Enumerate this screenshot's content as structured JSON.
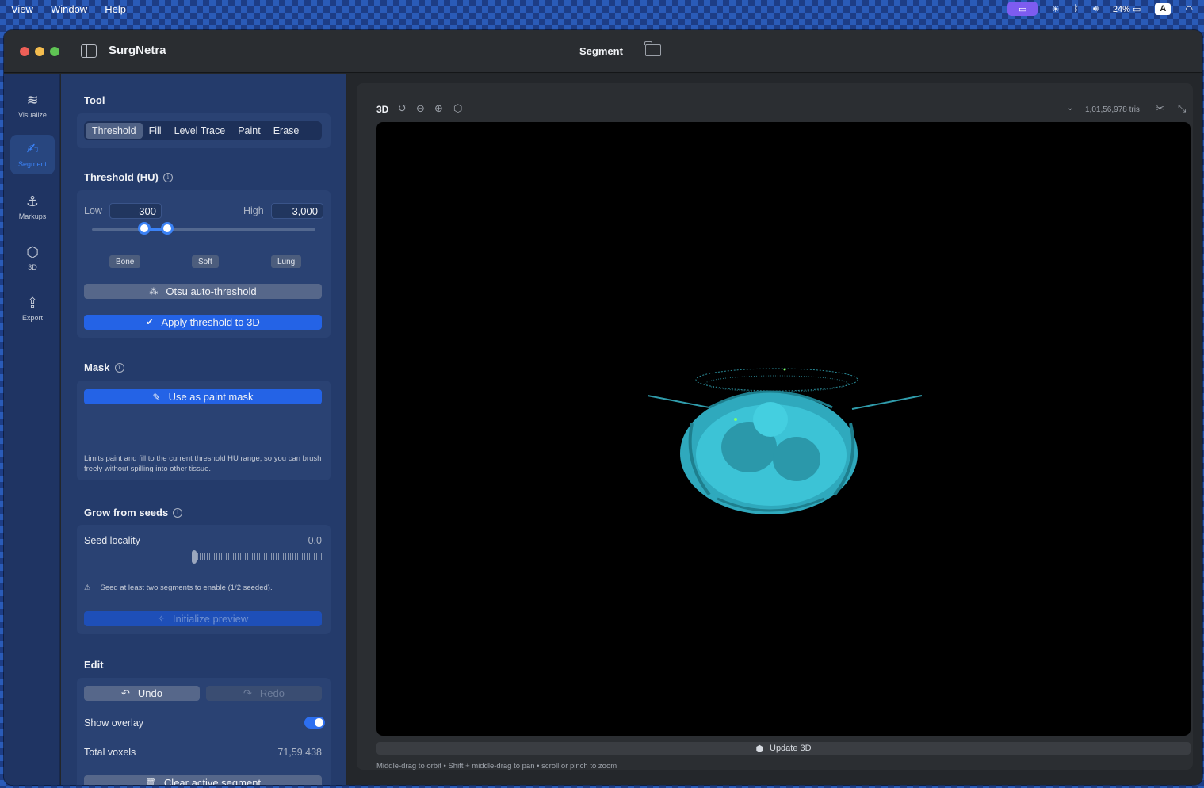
{
  "menubar": {
    "items": [
      "View",
      "Window",
      "Help"
    ],
    "battery": "24%",
    "input_source": "A"
  },
  "window": {
    "app_title": "SurgNetra",
    "title": "Segment"
  },
  "rail": {
    "items": [
      {
        "label": "Visualize",
        "icon": "layers-icon"
      },
      {
        "label": "Segment",
        "icon": "brush-icon",
        "active": true
      },
      {
        "label": "Markups",
        "icon": "pin-icon"
      },
      {
        "label": "3D",
        "icon": "cube-icon"
      },
      {
        "label": "Export",
        "icon": "share-icon"
      }
    ]
  },
  "tool": {
    "title": "Tool",
    "options": [
      "Threshold",
      "Fill",
      "Level Trace",
      "Paint",
      "Erase"
    ],
    "selected": "Threshold"
  },
  "threshold": {
    "title": "Threshold (HU)",
    "low_label": "Low",
    "low_value": "300",
    "high_label": "High",
    "high_value": "3,000",
    "presets": [
      "Bone",
      "Soft",
      "Lung"
    ],
    "otsu_label": "Otsu auto-threshold",
    "apply_label": "Apply threshold to 3D"
  },
  "mask": {
    "title": "Mask",
    "button_label": "Use as paint mask",
    "description": "Limits paint and fill to the current threshold HU range, so you can brush freely without spilling into other tissue."
  },
  "grow": {
    "title": "Grow from seeds",
    "seed_label": "Seed locality",
    "seed_value": "0.0",
    "warning": "Seed at least two segments to enable (1/2 seeded).",
    "init_label": "Initialize preview"
  },
  "edit": {
    "title": "Edit",
    "undo_label": "Undo",
    "redo_label": "Redo",
    "overlay_label": "Show overlay",
    "overlay_on": true,
    "voxels_label": "Total voxels",
    "voxels_value": "71,59,438",
    "clear_label": "Clear active segment"
  },
  "viewer": {
    "mode_label": "3D",
    "tri_count": "1,01,56,978 tris",
    "update_label": "Update 3D",
    "hint": "Middle-drag to orbit • Shift + middle-drag to pan • scroll or pinch to zoom",
    "render_color": "#3cc3d6"
  }
}
